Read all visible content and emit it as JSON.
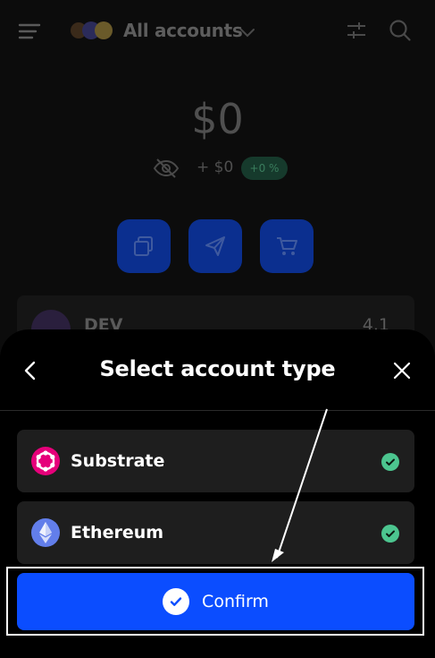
{
  "header": {
    "title": "All accounts",
    "icons": [
      "menu-icon",
      "account-logos",
      "chevron-down-icon",
      "filter-icon",
      "search-icon"
    ]
  },
  "wallet": {
    "balance": "$0",
    "change": "+ $0",
    "change_percent": "+0 %",
    "actions": [
      "copy-icon",
      "send-icon",
      "cart-icon"
    ]
  },
  "token_row": {
    "name": "DEV",
    "value": "4.1"
  },
  "sheet": {
    "title": "Select account type",
    "options": [
      {
        "label": "Substrate",
        "icon": "polkadot-icon",
        "selected": true
      },
      {
        "label": "Ethereum",
        "icon": "ethereum-icon",
        "selected": true
      }
    ],
    "confirm_label": "Confirm"
  },
  "colors": {
    "primary": "#0b4dff",
    "success": "#4cc58f",
    "substrate": "#e6007a",
    "ethereum": "#627eea",
    "sheet_bg": "#000000",
    "option_bg": "#1e1e1e"
  }
}
